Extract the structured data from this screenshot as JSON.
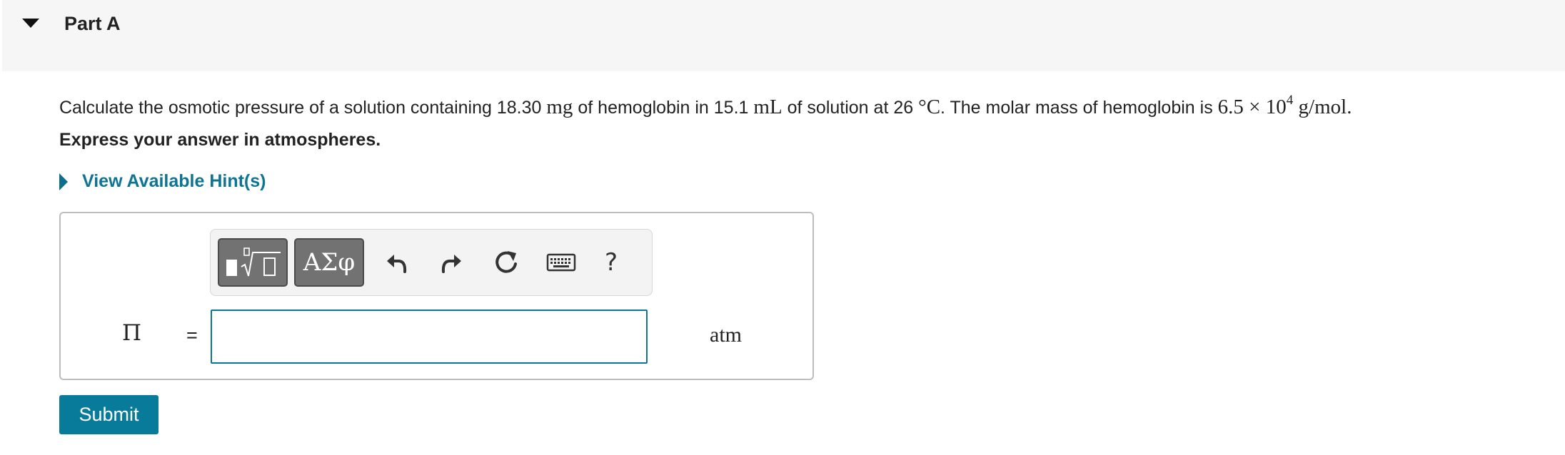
{
  "part": {
    "title": "Part A",
    "toggle_icon": "caret-down-icon"
  },
  "question": {
    "prefix": "Calculate the osmotic pressure of a solution containing 18.30",
    "mass_unit": "mg",
    "mid1": "of hemoglobin in 15.1",
    "volume_unit": "mL",
    "mid2": "of solution at 26",
    "temp_unit": "°C",
    "mid3": ". The molar mass of hemoglobin is",
    "molar_mass_coeff": "6.5 × 10",
    "molar_mass_exp": "4",
    "molar_mass_unit": "g/mol",
    "suffix": "."
  },
  "instruction": "Express your answer in atmospheres.",
  "hints": {
    "label": "View Available Hint(s)",
    "icon": "caret-right-icon"
  },
  "toolbar": {
    "templates_icon": "templates-sqrt-icon",
    "symbols_label": "ΑΣφ",
    "undo_icon": "undo-icon",
    "redo_icon": "redo-icon",
    "reset_icon": "reset-icon",
    "keyboard_icon": "keyboard-icon",
    "help_label": "?"
  },
  "answer": {
    "variable": "Π",
    "equals": "=",
    "value": "",
    "unit": "atm"
  },
  "submit": {
    "label": "Submit"
  },
  "colors": {
    "accent": "#087a9a",
    "link": "#0d7493",
    "header_bg": "#f6f6f6",
    "toolbar_button": "#727272"
  }
}
